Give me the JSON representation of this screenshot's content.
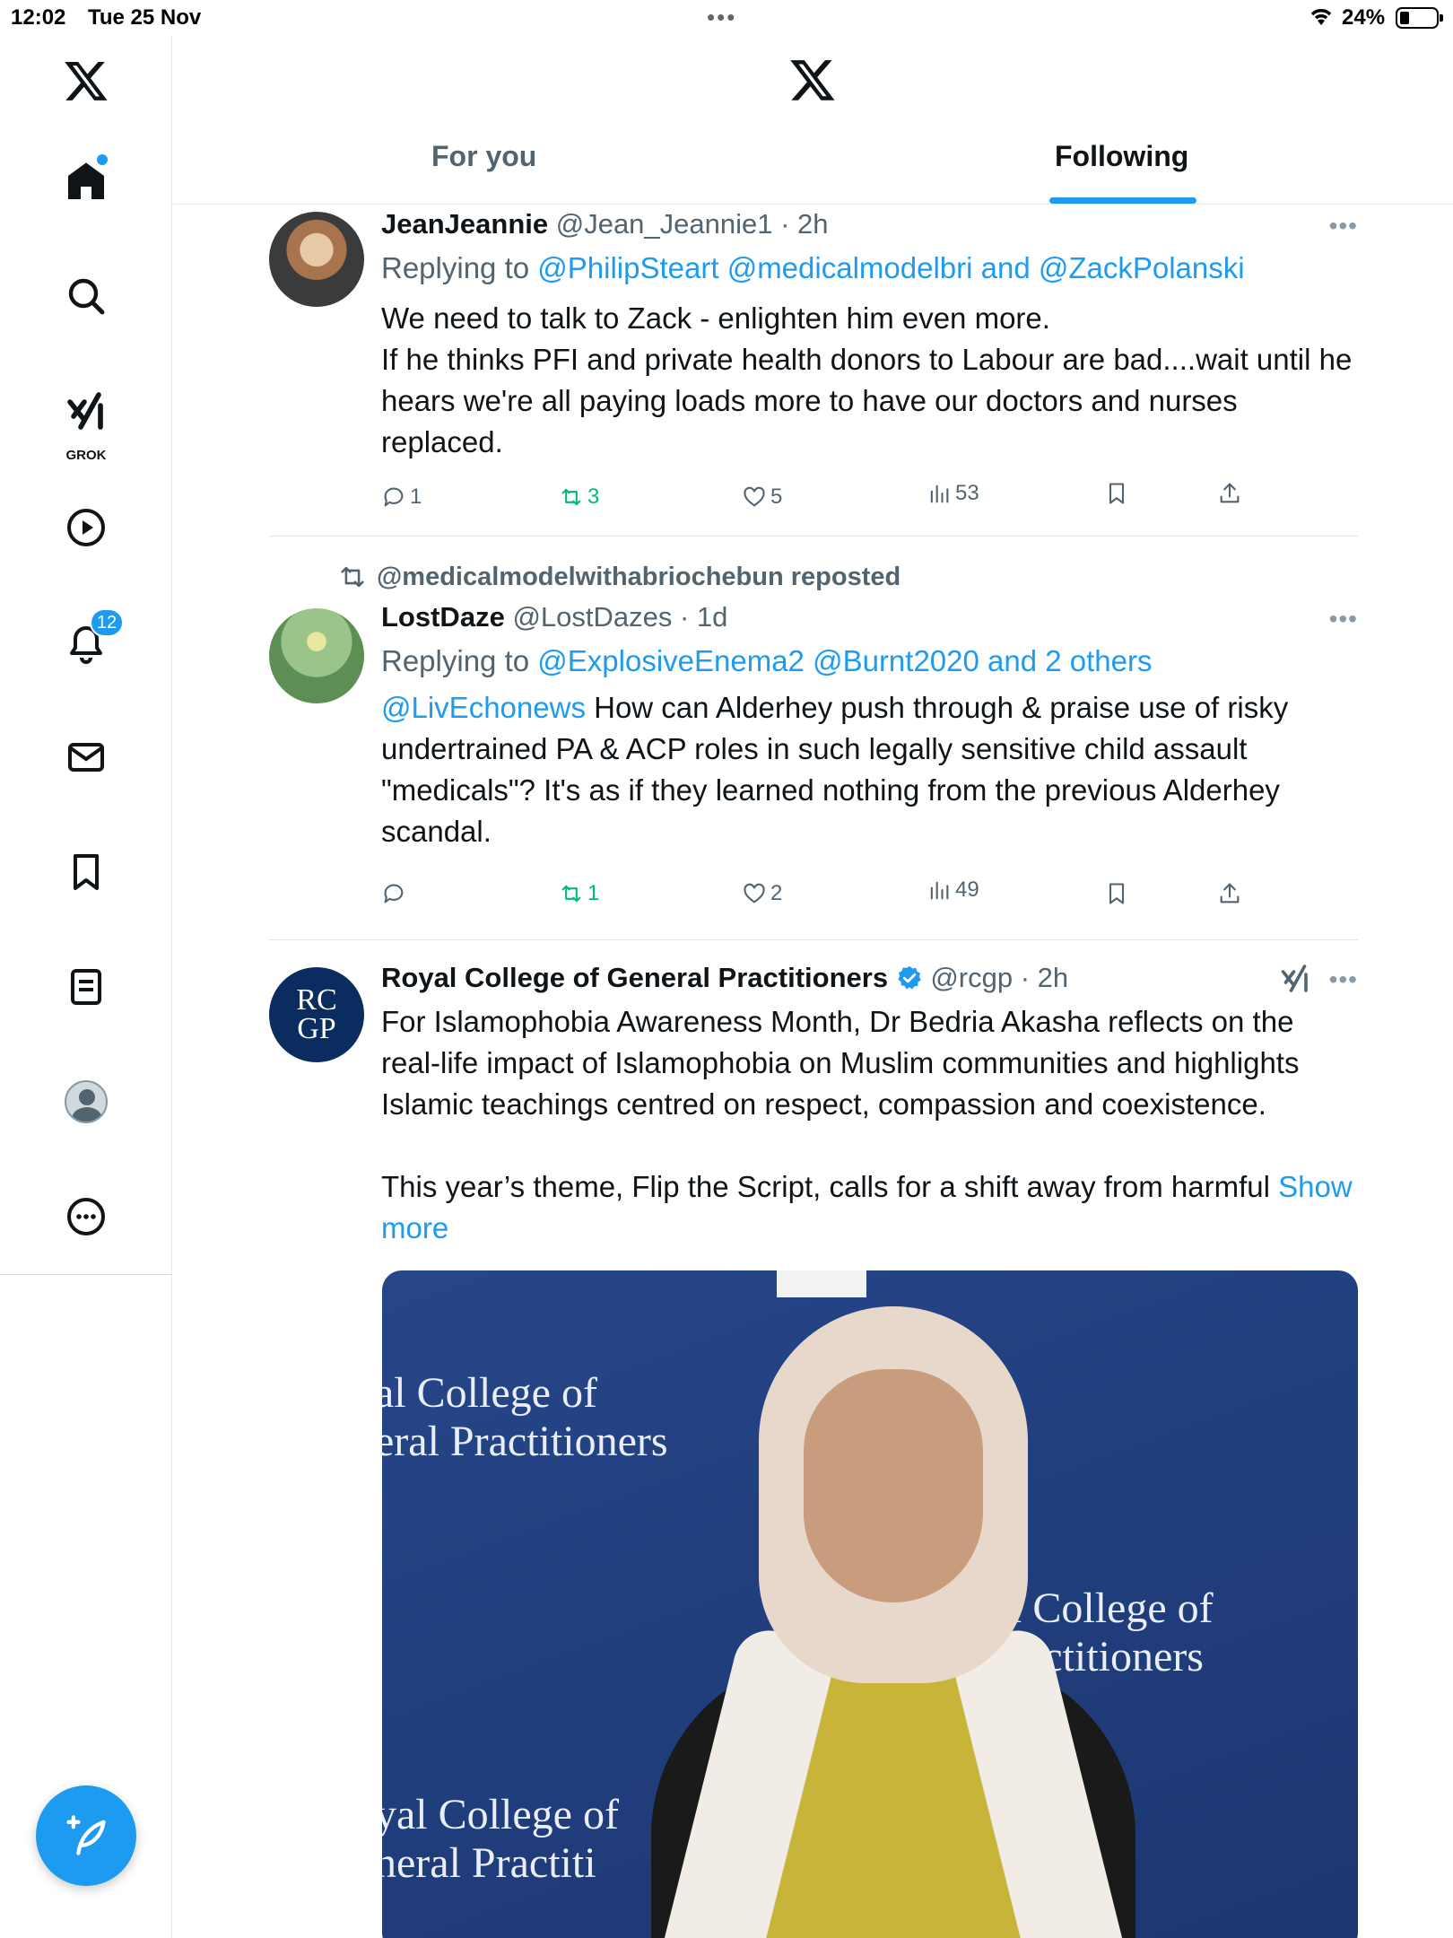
{
  "status_bar": {
    "time": "12:02",
    "date": "Tue 25 Nov",
    "battery": "24%"
  },
  "sidebar": {
    "notifications_badge": "12",
    "grok_label": "GROK"
  },
  "tabs": {
    "for_you": "For you",
    "following": "Following"
  },
  "tweets": [
    {
      "name": "JeanJeannie",
      "handle": "@Jean_Jeannie1",
      "time": "· 2h",
      "replying_prefix": "Replying to ",
      "replying_to": "@PhilipSteart @medicalmodelbri and @ZackPolanski",
      "text": "We need to talk to Zack - enlighten him even more.\n If he thinks PFI and private health donors to Labour are bad....wait until he hears we're all paying loads more to have our doctors and nurses replaced.",
      "replies": "1",
      "reposts": "3",
      "likes": "5",
      "views": "53"
    },
    {
      "reposted_by": "@medicalmodelwithabriochebun reposted",
      "name": "LostDaze",
      "handle": "@LostDazes",
      "time": "· 1d",
      "replying_prefix": "Replying to ",
      "replying_to": "@ExplosiveEnema2 @Burnt2020 and 2 others",
      "mention": "@LivEchonews",
      "text": " How can Alderhey push through & praise use of risky undertrained PA & ACP roles in such legally sensitive child assault \"medicals\"? It's as if they learned nothing from the previous Alderhey scandal.",
      "replies": "",
      "reposts": "1",
      "likes": "2",
      "views": "49"
    },
    {
      "name": "Royal College of General Practitioners",
      "handle": "@rcgp",
      "time": "· 2h",
      "avatar_text": "RC\nGP",
      "text": "For Islamophobia Awareness Month, Dr Bedria Akasha reflects on the real-life impact of Islamophobia on Muslim communities and highlights Islamic teachings centred on respect, compassion and coexistence.\n\nThis year’s theme, Flip the Script, calls for a shift away from harmful ",
      "show_more": "Show more",
      "media_text": {
        "line1": "al College of",
        "line2": "eral Practitioners",
        "line3": "l College of",
        "line4": "ractitioners",
        "line5": "yal College of",
        "line6": "neral Practiti"
      }
    }
  ],
  "colors": {
    "accent": "#1d9bf0",
    "repost_green": "#00ba7c",
    "secondary_text": "#536471"
  },
  "icons": [
    "x-logo",
    "home-icon",
    "search-icon",
    "grok-icon",
    "video-icon",
    "bell-icon",
    "mail-icon",
    "bookmark-icon",
    "lists-icon",
    "profile-icon",
    "more-icon",
    "compose-icon",
    "reply-icon",
    "repost-icon",
    "like-icon",
    "views-icon",
    "share-icon",
    "verified-icon"
  ]
}
